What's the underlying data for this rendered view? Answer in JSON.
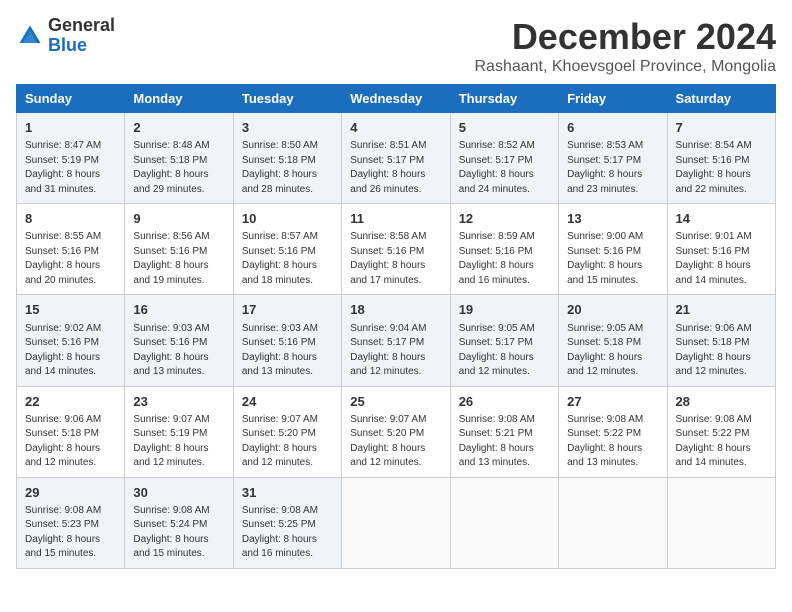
{
  "logo": {
    "general": "General",
    "blue": "Blue"
  },
  "title": "December 2024",
  "subtitle": "Rashaant, Khoevsgoel Province, Mongolia",
  "headers": [
    "Sunday",
    "Monday",
    "Tuesday",
    "Wednesday",
    "Thursday",
    "Friday",
    "Saturday"
  ],
  "weeks": [
    [
      {
        "day": "1",
        "info": "Sunrise: 8:47 AM\nSunset: 5:19 PM\nDaylight: 8 hours\nand 31 minutes."
      },
      {
        "day": "2",
        "info": "Sunrise: 8:48 AM\nSunset: 5:18 PM\nDaylight: 8 hours\nand 29 minutes."
      },
      {
        "day": "3",
        "info": "Sunrise: 8:50 AM\nSunset: 5:18 PM\nDaylight: 8 hours\nand 28 minutes."
      },
      {
        "day": "4",
        "info": "Sunrise: 8:51 AM\nSunset: 5:17 PM\nDaylight: 8 hours\nand 26 minutes."
      },
      {
        "day": "5",
        "info": "Sunrise: 8:52 AM\nSunset: 5:17 PM\nDaylight: 8 hours\nand 24 minutes."
      },
      {
        "day": "6",
        "info": "Sunrise: 8:53 AM\nSunset: 5:17 PM\nDaylight: 8 hours\nand 23 minutes."
      },
      {
        "day": "7",
        "info": "Sunrise: 8:54 AM\nSunset: 5:16 PM\nDaylight: 8 hours\nand 22 minutes."
      }
    ],
    [
      {
        "day": "8",
        "info": "Sunrise: 8:55 AM\nSunset: 5:16 PM\nDaylight: 8 hours\nand 20 minutes."
      },
      {
        "day": "9",
        "info": "Sunrise: 8:56 AM\nSunset: 5:16 PM\nDaylight: 8 hours\nand 19 minutes."
      },
      {
        "day": "10",
        "info": "Sunrise: 8:57 AM\nSunset: 5:16 PM\nDaylight: 8 hours\nand 18 minutes."
      },
      {
        "day": "11",
        "info": "Sunrise: 8:58 AM\nSunset: 5:16 PM\nDaylight: 8 hours\nand 17 minutes."
      },
      {
        "day": "12",
        "info": "Sunrise: 8:59 AM\nSunset: 5:16 PM\nDaylight: 8 hours\nand 16 minutes."
      },
      {
        "day": "13",
        "info": "Sunrise: 9:00 AM\nSunset: 5:16 PM\nDaylight: 8 hours\nand 15 minutes."
      },
      {
        "day": "14",
        "info": "Sunrise: 9:01 AM\nSunset: 5:16 PM\nDaylight: 8 hours\nand 14 minutes."
      }
    ],
    [
      {
        "day": "15",
        "info": "Sunrise: 9:02 AM\nSunset: 5:16 PM\nDaylight: 8 hours\nand 14 minutes."
      },
      {
        "day": "16",
        "info": "Sunrise: 9:03 AM\nSunset: 5:16 PM\nDaylight: 8 hours\nand 13 minutes."
      },
      {
        "day": "17",
        "info": "Sunrise: 9:03 AM\nSunset: 5:16 PM\nDaylight: 8 hours\nand 13 minutes."
      },
      {
        "day": "18",
        "info": "Sunrise: 9:04 AM\nSunset: 5:17 PM\nDaylight: 8 hours\nand 12 minutes."
      },
      {
        "day": "19",
        "info": "Sunrise: 9:05 AM\nSunset: 5:17 PM\nDaylight: 8 hours\nand 12 minutes."
      },
      {
        "day": "20",
        "info": "Sunrise: 9:05 AM\nSunset: 5:18 PM\nDaylight: 8 hours\nand 12 minutes."
      },
      {
        "day": "21",
        "info": "Sunrise: 9:06 AM\nSunset: 5:18 PM\nDaylight: 8 hours\nand 12 minutes."
      }
    ],
    [
      {
        "day": "22",
        "info": "Sunrise: 9:06 AM\nSunset: 5:18 PM\nDaylight: 8 hours\nand 12 minutes."
      },
      {
        "day": "23",
        "info": "Sunrise: 9:07 AM\nSunset: 5:19 PM\nDaylight: 8 hours\nand 12 minutes."
      },
      {
        "day": "24",
        "info": "Sunrise: 9:07 AM\nSunset: 5:20 PM\nDaylight: 8 hours\nand 12 minutes."
      },
      {
        "day": "25",
        "info": "Sunrise: 9:07 AM\nSunset: 5:20 PM\nDaylight: 8 hours\nand 12 minutes."
      },
      {
        "day": "26",
        "info": "Sunrise: 9:08 AM\nSunset: 5:21 PM\nDaylight: 8 hours\nand 13 minutes."
      },
      {
        "day": "27",
        "info": "Sunrise: 9:08 AM\nSunset: 5:22 PM\nDaylight: 8 hours\nand 13 minutes."
      },
      {
        "day": "28",
        "info": "Sunrise: 9:08 AM\nSunset: 5:22 PM\nDaylight: 8 hours\nand 14 minutes."
      }
    ],
    [
      {
        "day": "29",
        "info": "Sunrise: 9:08 AM\nSunset: 5:23 PM\nDaylight: 8 hours\nand 15 minutes."
      },
      {
        "day": "30",
        "info": "Sunrise: 9:08 AM\nSunset: 5:24 PM\nDaylight: 8 hours\nand 15 minutes."
      },
      {
        "day": "31",
        "info": "Sunrise: 9:08 AM\nSunset: 5:25 PM\nDaylight: 8 hours\nand 16 minutes."
      },
      {
        "day": "",
        "info": ""
      },
      {
        "day": "",
        "info": ""
      },
      {
        "day": "",
        "info": ""
      },
      {
        "day": "",
        "info": ""
      }
    ]
  ]
}
